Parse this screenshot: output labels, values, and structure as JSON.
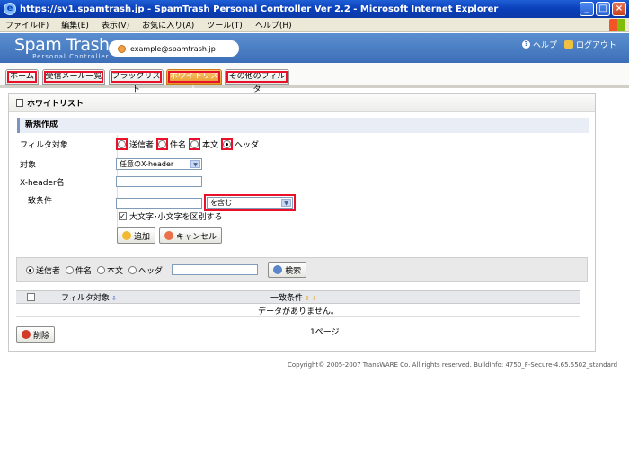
{
  "window": {
    "title": "https://sv1.spamtrash.jp - SpamTrash Personal Controller Ver 2.2 - Microsoft Internet Explorer",
    "minimize": "_",
    "maximize": "□",
    "close": "×"
  },
  "menu": [
    "ファイル(F)",
    "編集(E)",
    "表示(V)",
    "お気に入り(A)",
    "ツール(T)",
    "ヘルプ(H)"
  ],
  "app": {
    "logo": "Spam Trash",
    "logo_sub": "Personal Controller",
    "user_email": "example@spamtrash.jp",
    "help": "ヘルプ",
    "logout": "ログアウト"
  },
  "tabs": [
    "ホーム",
    "受信メール一覧",
    "ブラックリスト",
    "ホワイトリスト",
    "その他のフィルタ"
  ],
  "panel": {
    "title": "ホワイトリスト",
    "section": "新規作成",
    "form": {
      "filter_target_label": "フィルタ対象",
      "filter_options": [
        "送信者",
        "件名",
        "本文",
        "ヘッダ"
      ],
      "target_label": "対象",
      "target_value": "任意のX-header",
      "xheader_label": "X-header名",
      "match_label": "一致条件",
      "match_value": "を含む",
      "case_sensitive": "大文字･小文字を区別する",
      "add_button": "追加",
      "cancel_button": "キャンセル"
    },
    "search": {
      "options": [
        "送信者",
        "件名",
        "本文",
        "ヘッダ"
      ],
      "button": "検索"
    },
    "table": {
      "col_filter": "フィルタ対象",
      "col_match": "一致条件",
      "empty": "データがありません。",
      "page": "1ページ"
    },
    "delete_button": "削除"
  },
  "footer": "Copyright© 2005-2007 TransWARE Co. All rights reserved. BuildInfo: 4750_F-Secure-4.65.5502_standard"
}
